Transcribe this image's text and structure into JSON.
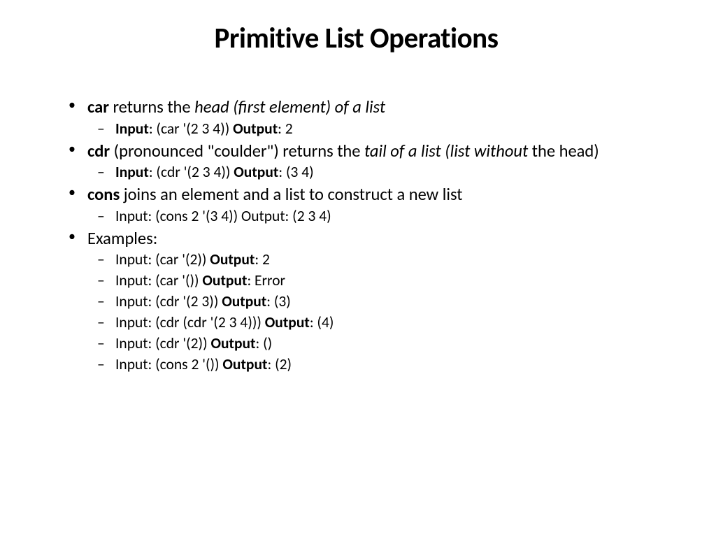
{
  "title": "Primitive List Operations",
  "bullets": [
    {
      "segments": [
        {
          "text": "car",
          "bold": true
        },
        {
          "text": " returns the "
        },
        {
          "text": "head (first element) of a list",
          "italic": true
        }
      ],
      "sub": [
        {
          "segments": [
            {
              "text": "Input",
              "bold": true
            },
            {
              "text": ": (car '(2 3 4))   "
            },
            {
              "text": "Output",
              "bold": true
            },
            {
              "text": ": 2"
            }
          ]
        }
      ]
    },
    {
      "segments": [
        {
          "text": "cdr",
          "bold": true
        },
        {
          "text": " (pronounced \"coulder\") returns the "
        },
        {
          "text": "tail of a list (list without ",
          "italic": true
        },
        {
          "text": "the head)"
        }
      ],
      "sub": [
        {
          "segments": [
            {
              "text": "Input",
              "bold": true
            },
            {
              "text": ": (cdr '(2 3 4)) "
            },
            {
              "text": "Output",
              "bold": true
            },
            {
              "text": ": (3 4)"
            }
          ]
        }
      ]
    },
    {
      "segments": [
        {
          "text": "cons",
          "bold": true
        },
        {
          "text": " joins an element and a list to construct a new list"
        }
      ],
      "sub": [
        {
          "segments": [
            {
              "text": "Input: (cons 2 '(3 4))    Output: (2 3 4)"
            }
          ]
        }
      ]
    },
    {
      "segments": [
        {
          "text": "Examples:"
        }
      ],
      "sub": [
        {
          "segments": [
            {
              "text": "Input: (car '(2)) "
            },
            {
              "text": "Output",
              "bold": true
            },
            {
              "text": ": 2"
            }
          ]
        },
        {
          "segments": [
            {
              "text": "Input: (car '()) "
            },
            {
              "text": "Output",
              "bold": true
            },
            {
              "text": ": Error"
            }
          ]
        },
        {
          "segments": [
            {
              "text": "Input: (cdr '(2 3)) "
            },
            {
              "text": "Output",
              "bold": true
            },
            {
              "text": ": (3)"
            }
          ]
        },
        {
          "segments": [
            {
              "text": "Input: (cdr (cdr '(2 3 4))) "
            },
            {
              "text": "Output",
              "bold": true
            },
            {
              "text": ": (4)"
            }
          ]
        },
        {
          "segments": [
            {
              "text": "Input: (cdr '(2)) "
            },
            {
              "text": "Output",
              "bold": true
            },
            {
              "text": ": ()"
            }
          ]
        },
        {
          "segments": [
            {
              "text": "Input: (cons 2 '()) "
            },
            {
              "text": "Output",
              "bold": true
            },
            {
              "text": ": (2)"
            }
          ]
        }
      ]
    }
  ]
}
